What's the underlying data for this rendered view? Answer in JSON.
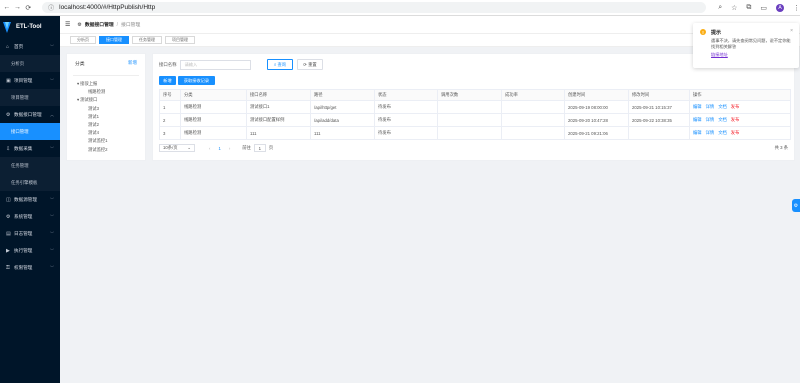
{
  "browser": {
    "url": "localhost:4000/#/HttpPublish/Http",
    "avatar_letter": "A"
  },
  "app": {
    "title": "ETL-Tool",
    "brand_color": "#1890ff",
    "sidebar_bg": "#001529"
  },
  "sidebar": {
    "items": [
      {
        "type": "group",
        "label": "首页",
        "icon": "home-icon"
      },
      {
        "type": "sub",
        "label": "分析页"
      },
      {
        "type": "group",
        "label": "项目管理",
        "icon": "project-icon"
      },
      {
        "type": "sub",
        "label": "项目管理"
      },
      {
        "type": "group",
        "label": "数据接口管理",
        "icon": "api-icon",
        "expanded": true
      },
      {
        "type": "sub",
        "label": "接口管理",
        "active": true
      },
      {
        "type": "group",
        "label": "数据采集",
        "icon": "collect-icon"
      },
      {
        "type": "sub",
        "label": "任务管理"
      },
      {
        "type": "sub",
        "label": "任务引擎模板"
      },
      {
        "type": "group",
        "label": "数据源管理",
        "icon": "datasource-icon"
      },
      {
        "type": "group",
        "label": "系统管理",
        "icon": "system-icon"
      },
      {
        "type": "group",
        "label": "日志管理",
        "icon": "log-icon"
      },
      {
        "type": "group",
        "label": "执行管理",
        "icon": "exec-icon"
      },
      {
        "type": "group",
        "label": "权限管理",
        "icon": "permission-icon"
      }
    ]
  },
  "header": {
    "breadcrumb_1": "数据接口管理",
    "breadcrumb_2": "接口管理"
  },
  "tabs": [
    {
      "label": "分析页",
      "active": false
    },
    {
      "label": "接口管理",
      "active": true
    },
    {
      "label": "任务管理",
      "active": false
    },
    {
      "label": "项目管理",
      "active": false
    }
  ],
  "category": {
    "title": "分类",
    "new_label": "新增",
    "tree": [
      {
        "label": "接驳上报",
        "level": 0,
        "toggle": "▾"
      },
      {
        "label": "线路检测",
        "level": 1
      },
      {
        "label": "测试接口",
        "level": 0,
        "toggle": "▾"
      },
      {
        "label": "测试3",
        "level": 1
      },
      {
        "label": "测试1",
        "level": 1
      },
      {
        "label": "测试2",
        "level": 1
      },
      {
        "label": "测试4",
        "level": 1
      },
      {
        "label": "测试监控1",
        "level": 1
      },
      {
        "label": "测试监控2",
        "level": 1
      }
    ]
  },
  "search": {
    "label": "接口名称",
    "placeholder": "请输入",
    "search_button": "查询",
    "reset_button": "重置"
  },
  "toolbar": {
    "add_label": "新增",
    "fetch_label": "获取接收记录"
  },
  "table": {
    "columns": [
      "序号",
      "分类",
      "接口名称",
      "路径",
      "状态",
      "调用次数",
      "成功率",
      "创建时间",
      "修改时间",
      "操作"
    ],
    "rows": [
      [
        "1",
        "线路检测",
        "测试接口1",
        "/api/http/get",
        "待发布",
        "",
        "",
        "2025-09-19 08:00:00",
        "2025-09-21 10:15:37"
      ],
      [
        "2",
        "线路检测",
        "测试接口配置样例",
        "/api/add/data",
        "待发布",
        "",
        "",
        "2025-09-20 10:47:28",
        "2025-09-22 10:38:35"
      ],
      [
        "3",
        "线路检测",
        "111",
        "111",
        "待发布",
        "",
        "",
        "2025-09-21 09:21:06",
        ""
      ]
    ],
    "actions": [
      {
        "label": "编辑",
        "danger": false
      },
      {
        "label": "详情",
        "danger": false
      },
      {
        "label": "文档",
        "danger": false
      },
      {
        "label": "发布",
        "danger": true
      }
    ]
  },
  "pagination": {
    "page_size": "10条/页",
    "prev": "‹",
    "current": "1",
    "next": "›",
    "goto_label": "前往",
    "goto_value": "1",
    "page_unit": "页",
    "total": "共 3 条"
  },
  "notification": {
    "title": "提示",
    "body": "遇事不决，请先查阅常见问题，说不定你能找到相关解答",
    "link": "链接地址"
  }
}
